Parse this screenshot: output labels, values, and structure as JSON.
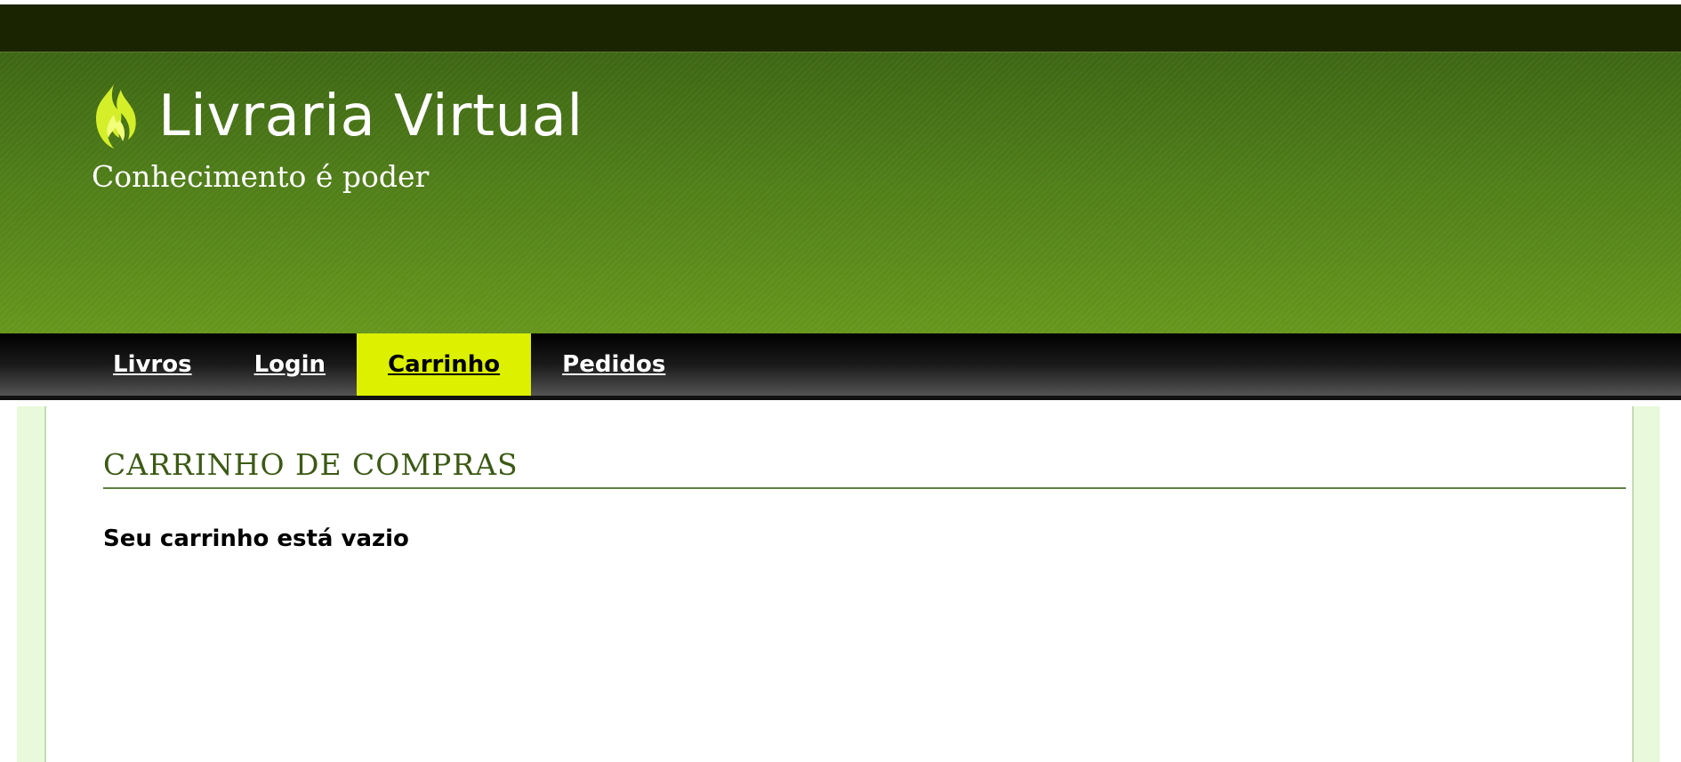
{
  "site": {
    "title": "Livraria Virtual",
    "tagline": "Conhecimento é poder",
    "logo_icon": "flame-icon"
  },
  "nav": {
    "items": [
      {
        "label": "Livros",
        "active": false
      },
      {
        "label": "Login",
        "active": false
      },
      {
        "label": "Carrinho",
        "active": true
      },
      {
        "label": "Pedidos",
        "active": false
      }
    ]
  },
  "main": {
    "heading": "CARRINHO DE COMPRAS",
    "empty_message": "Seu carrinho está vazio"
  },
  "colors": {
    "header_green": "#4f7d18",
    "active_tab": "#dcf000",
    "heading_green": "#3b5a14",
    "side_panel": "#e9f9dc"
  }
}
